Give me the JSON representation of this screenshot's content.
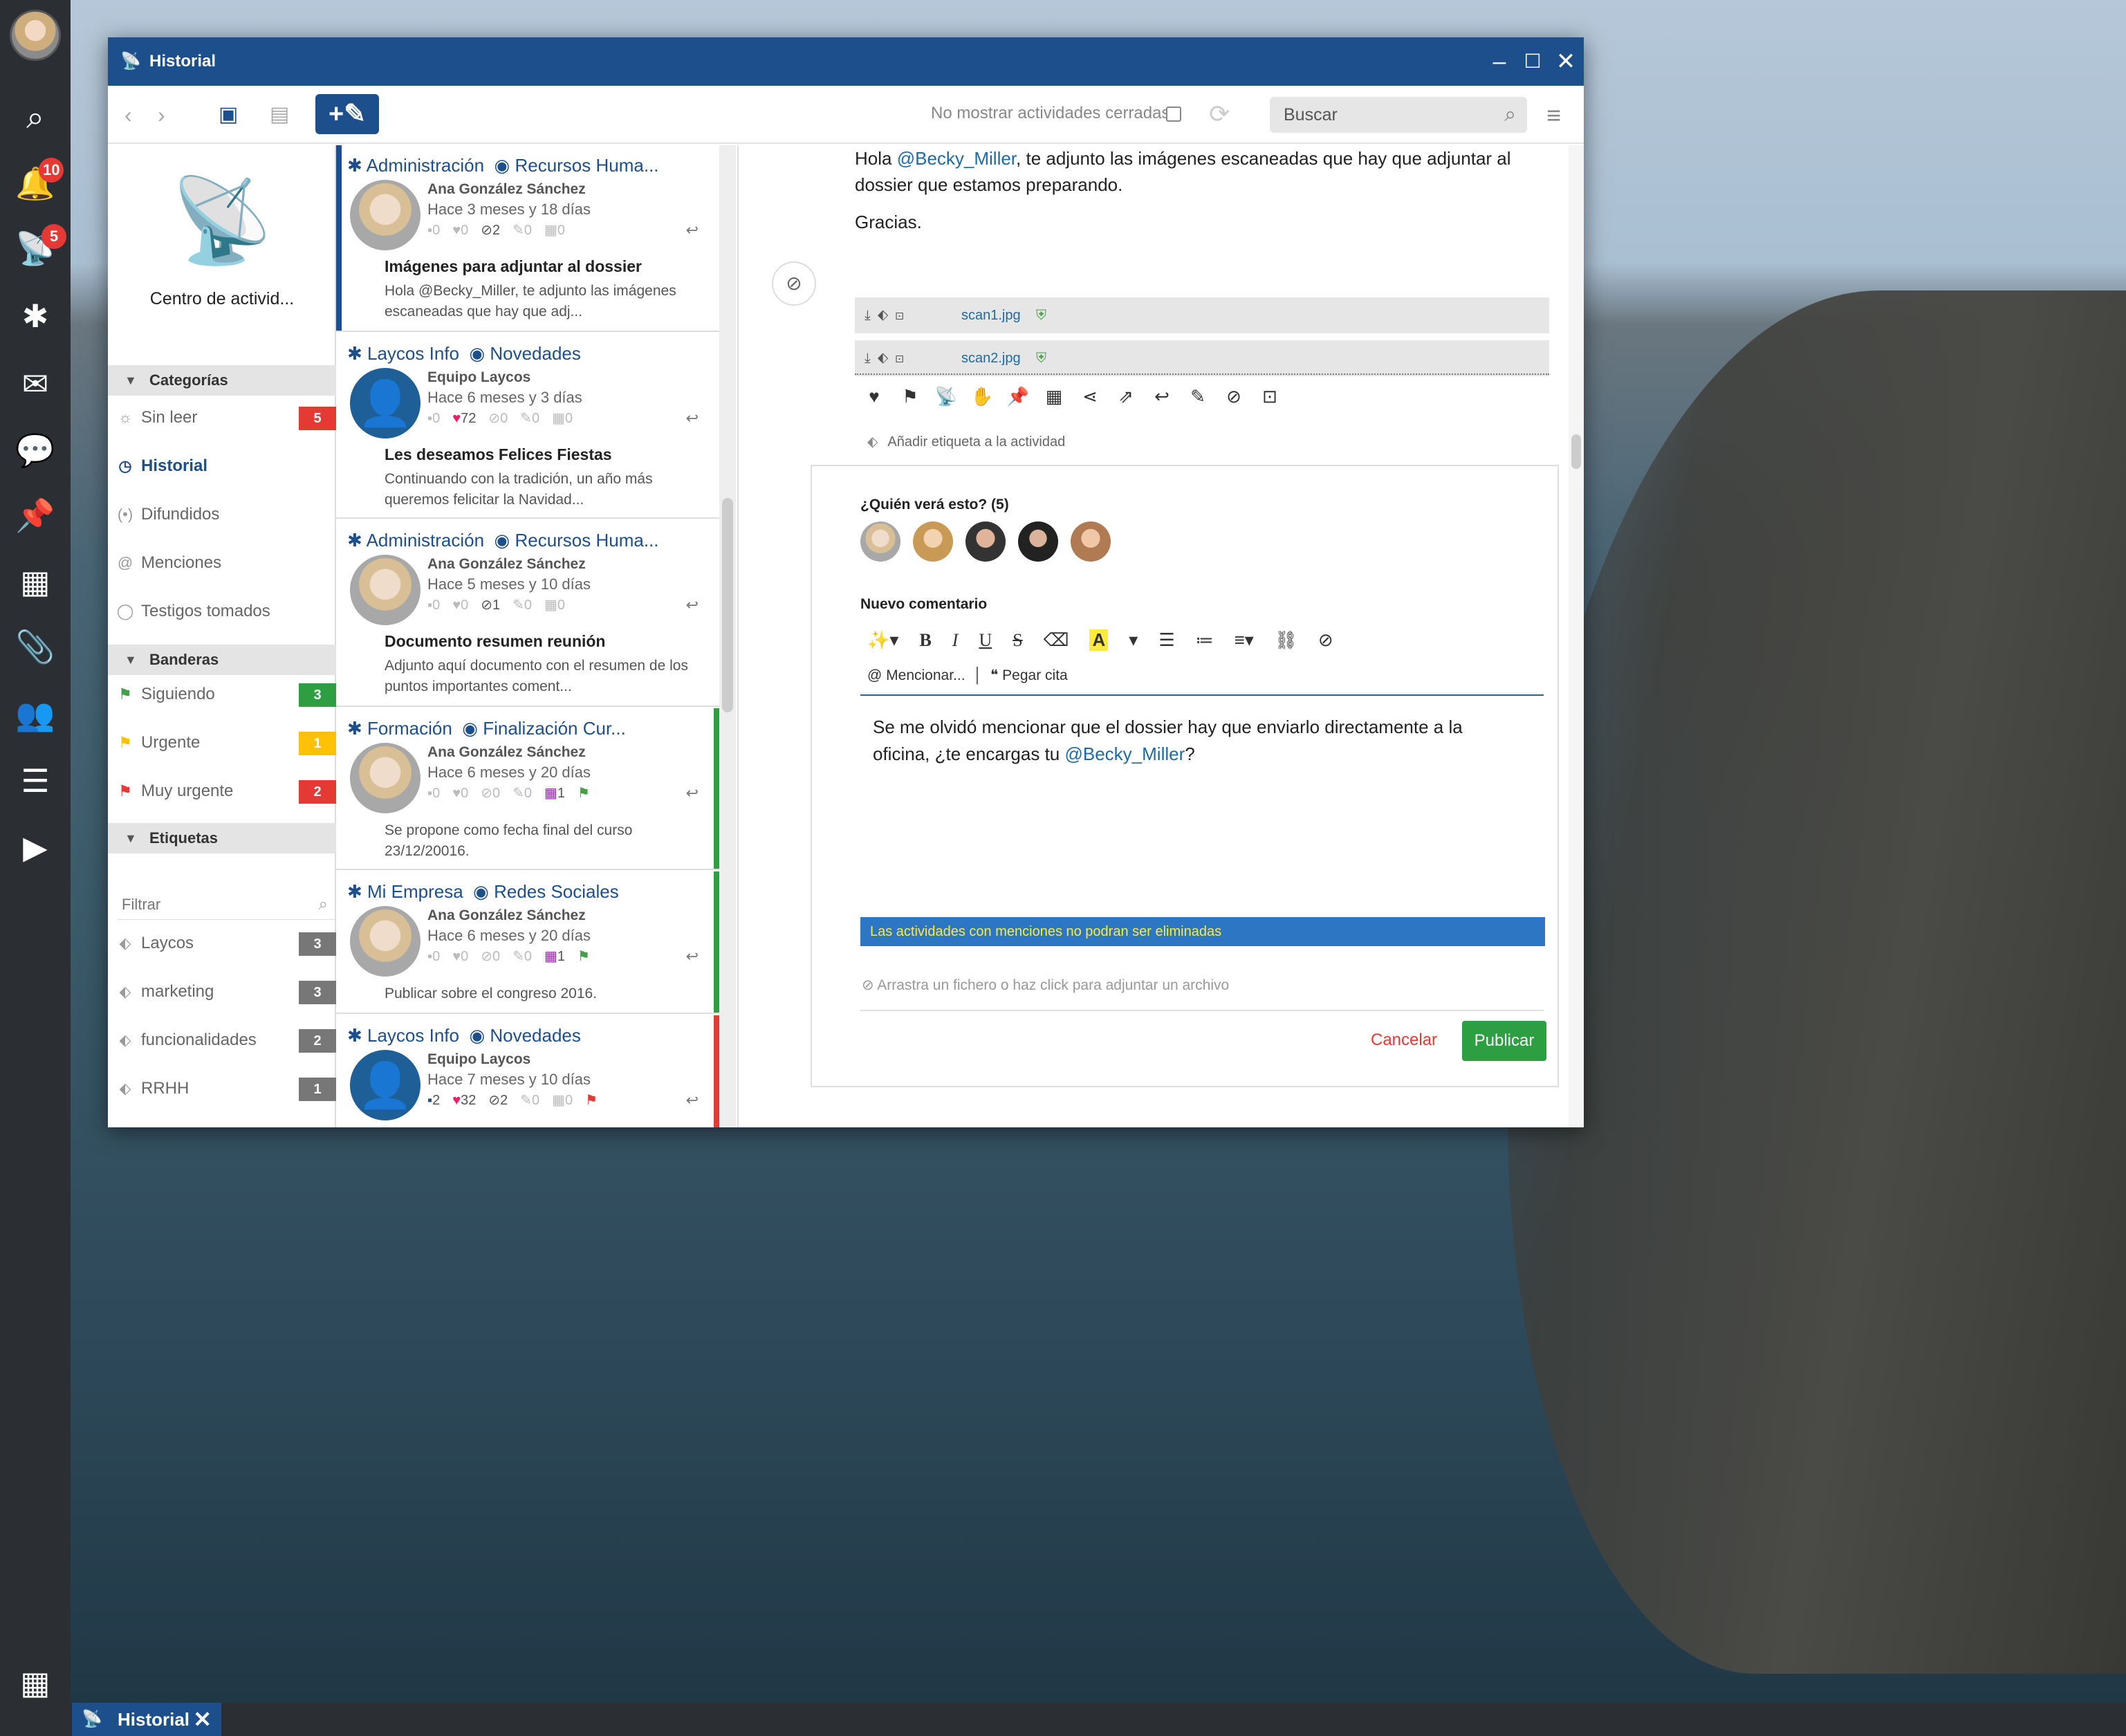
{
  "window": {
    "title": "Historial"
  },
  "taskbar": {
    "label": "Historial"
  },
  "leftbar": {
    "notifications_badge": "10",
    "broadcast_badge": "5"
  },
  "toolbar": {
    "hide_closed_label": "No mostrar actividades cerradas",
    "search_placeholder": "Buscar"
  },
  "sidebar": {
    "center_label": "Centro de activid...",
    "categories_header": "Categorías",
    "categories": [
      {
        "label": "Sin leer",
        "count": "5"
      },
      {
        "label": "Historial",
        "count": ""
      },
      {
        "label": "Difundidos",
        "count": ""
      },
      {
        "label": "Menciones",
        "count": ""
      },
      {
        "label": "Testigos tomados",
        "count": ""
      }
    ],
    "flags_header": "Banderas",
    "flags": [
      {
        "label": "Siguiendo",
        "count": "3"
      },
      {
        "label": "Urgente",
        "count": "1"
      },
      {
        "label": "Muy urgente",
        "count": "2"
      }
    ],
    "tags_header": "Etiquetas",
    "filter_placeholder": "Filtrar",
    "tags": [
      {
        "label": "Laycos",
        "count": "3"
      },
      {
        "label": "marketing",
        "count": "3"
      },
      {
        "label": "funcionalidades",
        "count": "2"
      },
      {
        "label": "RRHH",
        "count": "1"
      }
    ]
  },
  "activities": [
    {
      "group": "Administración",
      "sub": "Recursos Huma...",
      "author": "Ana González Sánchez",
      "time": "Hace 3 meses y 18 días",
      "comments": "0",
      "likes": "0",
      "attachments": "2",
      "pins": "0",
      "events": "0",
      "title": "Imágenes para adjuntar al dossier",
      "excerpt": "Hola @Becky_Miller, te adjunto las imágenes escaneadas que hay que adj..."
    },
    {
      "group": "Laycos Info",
      "sub": "Novedades",
      "author": "Equipo Laycos",
      "time": "Hace 6 meses y 3 días",
      "comments": "0",
      "likes": "72",
      "attachments": "0",
      "pins": "0",
      "events": "0",
      "title": "Les deseamos Felices Fiestas",
      "excerpt": "Continuando con la tradición, un año más queremos felicitar la Navidad..."
    },
    {
      "group": "Administración",
      "sub": "Recursos Huma...",
      "author": "Ana González Sánchez",
      "time": "Hace 5 meses y 10 días",
      "comments": "0",
      "likes": "0",
      "attachments": "1",
      "pins": "0",
      "events": "0",
      "title": "Documento resumen reunión",
      "excerpt": "Adjunto aquí documento con el resumen de los puntos importantes coment..."
    },
    {
      "group": "Formación",
      "sub": "Finalización Cur...",
      "author": "Ana González Sánchez",
      "time": "Hace 6 meses y 20 días",
      "comments": "0",
      "likes": "0",
      "attachments": "0",
      "pins": "0",
      "events": "1",
      "title": "",
      "excerpt": "Se propone como fecha final del curso 23/12/20016."
    },
    {
      "group": "Mi Empresa",
      "sub": "Redes Sociales",
      "author": "Ana González Sánchez",
      "time": "Hace 6 meses y 20 días",
      "comments": "0",
      "likes": "0",
      "attachments": "0",
      "pins": "0",
      "events": "1",
      "title": "",
      "excerpt": "Publicar sobre el congreso 2016."
    },
    {
      "group": "Laycos Info",
      "sub": "Novedades",
      "author": "Equipo Laycos",
      "time": "Hace 7 meses y 10 días",
      "comments": "2",
      "likes": "32",
      "attachments": "2",
      "pins": "0",
      "events": "0",
      "title": "",
      "excerpt": ""
    }
  ],
  "detail": {
    "message_pre": "Hola ",
    "message_mention": "@Becky_Miller",
    "message_post": ", te adjunto las imágenes escaneadas que hay que adjuntar al dossier que estamos preparando.",
    "thanks": "Gracias.",
    "attachments": [
      {
        "name": "scan1.jpg"
      },
      {
        "name": "scan2.jpg"
      }
    ],
    "add_tag": "Añadir etiqueta a la actividad",
    "who_sees": "¿Quién verá esto? (5)",
    "new_comment": "Nuevo comentario",
    "mention_btn": "Mencionar...",
    "quote_btn": "Pegar cita",
    "comment_pre": "Se me olvidó mencionar que el dossier hay que enviarlo directamente a la oficina, ¿te encargas tu ",
    "comment_mention": "@Becky_Miller",
    "comment_post": "?",
    "warning": "Las actividades con menciones no podran ser eliminadas",
    "drop_hint": "Arrastra un fichero o haz click para adjuntar un archivo",
    "cancel": "Cancelar",
    "publish": "Publicar"
  },
  "colors": {
    "brand": "#1d4f8d",
    "green": "#2e9e43",
    "red": "#e53935",
    "yellow": "#ffc107"
  }
}
